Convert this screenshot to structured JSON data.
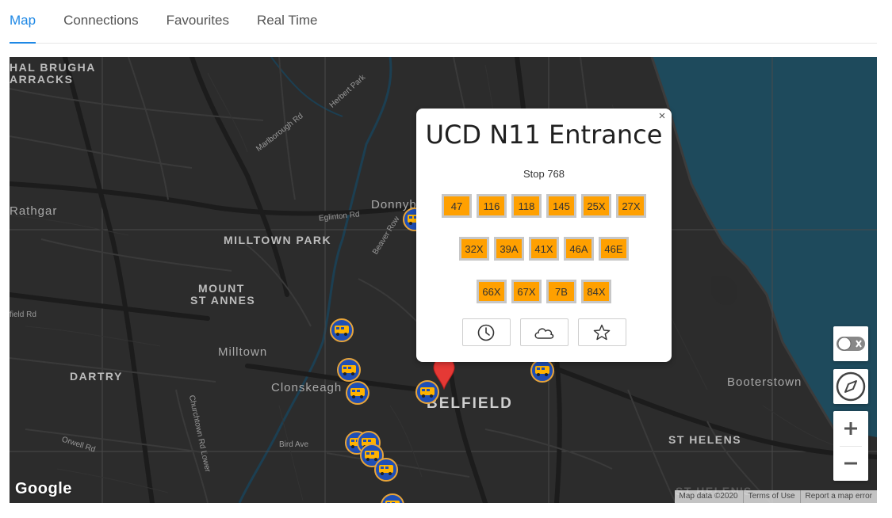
{
  "tabs": [
    {
      "label": "Map",
      "active": true
    },
    {
      "label": "Connections",
      "active": false
    },
    {
      "label": "Favourites",
      "active": false
    },
    {
      "label": "Real Time",
      "active": false
    }
  ],
  "map": {
    "labels": {
      "hal_brugha": "HAL BRUGHA",
      "barracks": "ARRACKS",
      "rathgar": "Rathgar",
      "milltown_park": "MILLTOWN PARK",
      "mount": "MOUNT",
      "st_annes": "ST ANNES",
      "milltown": "Milltown",
      "dartry": "DARTRY",
      "clonskeagh": "Clonskeagh",
      "belfield": "BELFIELD",
      "booterstown": "Booterstown",
      "st_helens": "ST HELENS",
      "st_helens_2": "ST HELEN'S",
      "donnybrook": "Donnyb",
      "herbert_park": "Herbert Park",
      "marlborough_rd": "Marlborough Rd",
      "eglinton_rd": "Eglinton Rd",
      "beaver_row": "Beaver Row",
      "field_rd": "field Rd",
      "churchtown_rd": "Churchtown Rd Lower",
      "orwell_rd": "Orwell Rd",
      "bird_ave": "Bird Ave"
    },
    "google_logo": "Google",
    "attribution": [
      "Map data ©2020",
      "Terms of Use",
      "Report a map error"
    ],
    "colors": {
      "land": "#2c2c2c",
      "water": "#1e4a5c",
      "marker_fill": "#1f4fb5",
      "marker_ring": "#e8a53a",
      "route_button": "#ffa000",
      "pin": "#e53935"
    }
  },
  "popup": {
    "title": "UCD N11 Entrance",
    "stop": "Stop 768",
    "close": "×",
    "route_rows": [
      [
        "47",
        "116",
        "118",
        "145",
        "25X",
        "27X"
      ],
      [
        "32X",
        "39A",
        "41X",
        "46A",
        "46E"
      ],
      [
        "66X",
        "67X",
        "7B",
        "84X"
      ]
    ],
    "actions": [
      "clock-icon",
      "cloud-icon",
      "star-icon"
    ]
  },
  "controls": {
    "toggle": "toggle-icon",
    "compass": "compass-icon",
    "zoom_in": "+",
    "zoom_out": "−"
  }
}
